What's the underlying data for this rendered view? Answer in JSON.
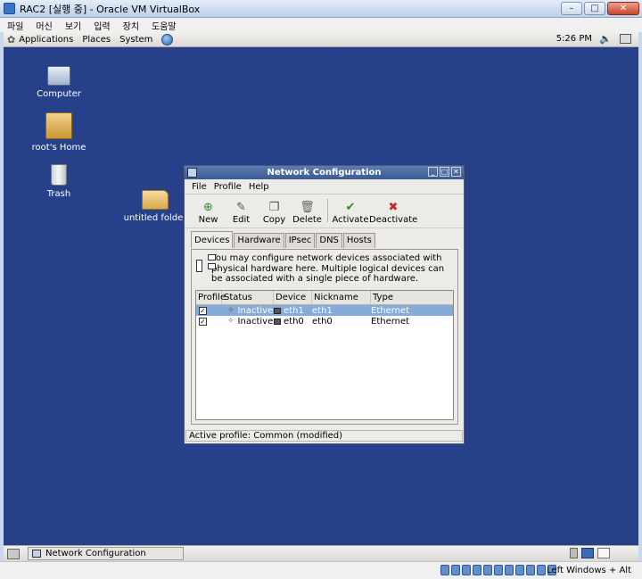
{
  "vbox": {
    "title": "RAC2 [실행 중] - Oracle VM VirtualBox",
    "menu": [
      "파일",
      "머신",
      "보기",
      "입력",
      "장치",
      "도움말"
    ],
    "status_hostkey": "Left Windows + Alt"
  },
  "top_panel": {
    "menus": [
      "Applications",
      "Places",
      "System"
    ],
    "clock": "5:26 PM"
  },
  "desktop": {
    "icons": [
      "Computer",
      "root's Home",
      "Trash",
      "untitled folder"
    ]
  },
  "netconf": {
    "title": "Network Configuration",
    "menu": [
      "File",
      "Profile",
      "Help"
    ],
    "toolbar": [
      "New",
      "Edit",
      "Copy",
      "Delete",
      "Activate",
      "Deactivate"
    ],
    "tabs": [
      "Devices",
      "Hardware",
      "IPsec",
      "DNS",
      "Hosts"
    ],
    "info": "You may configure network devices associated with physical hardware here.  Multiple logical devices can be associated with a single piece of hardware.",
    "columns": [
      "Profile",
      "Status",
      "Device",
      "Nickname",
      "Type"
    ],
    "rows": [
      {
        "checked": "✓",
        "status": "Inactive",
        "device": "eth1",
        "nickname": "eth1",
        "type": "Ethernet"
      },
      {
        "checked": "✓",
        "status": "Inactive",
        "device": "eth0",
        "nickname": "eth0",
        "type": "Ethernet"
      }
    ],
    "statusbar": "Active profile: Common (modified)"
  },
  "bottom_panel": {
    "task": "Network Configuration"
  }
}
